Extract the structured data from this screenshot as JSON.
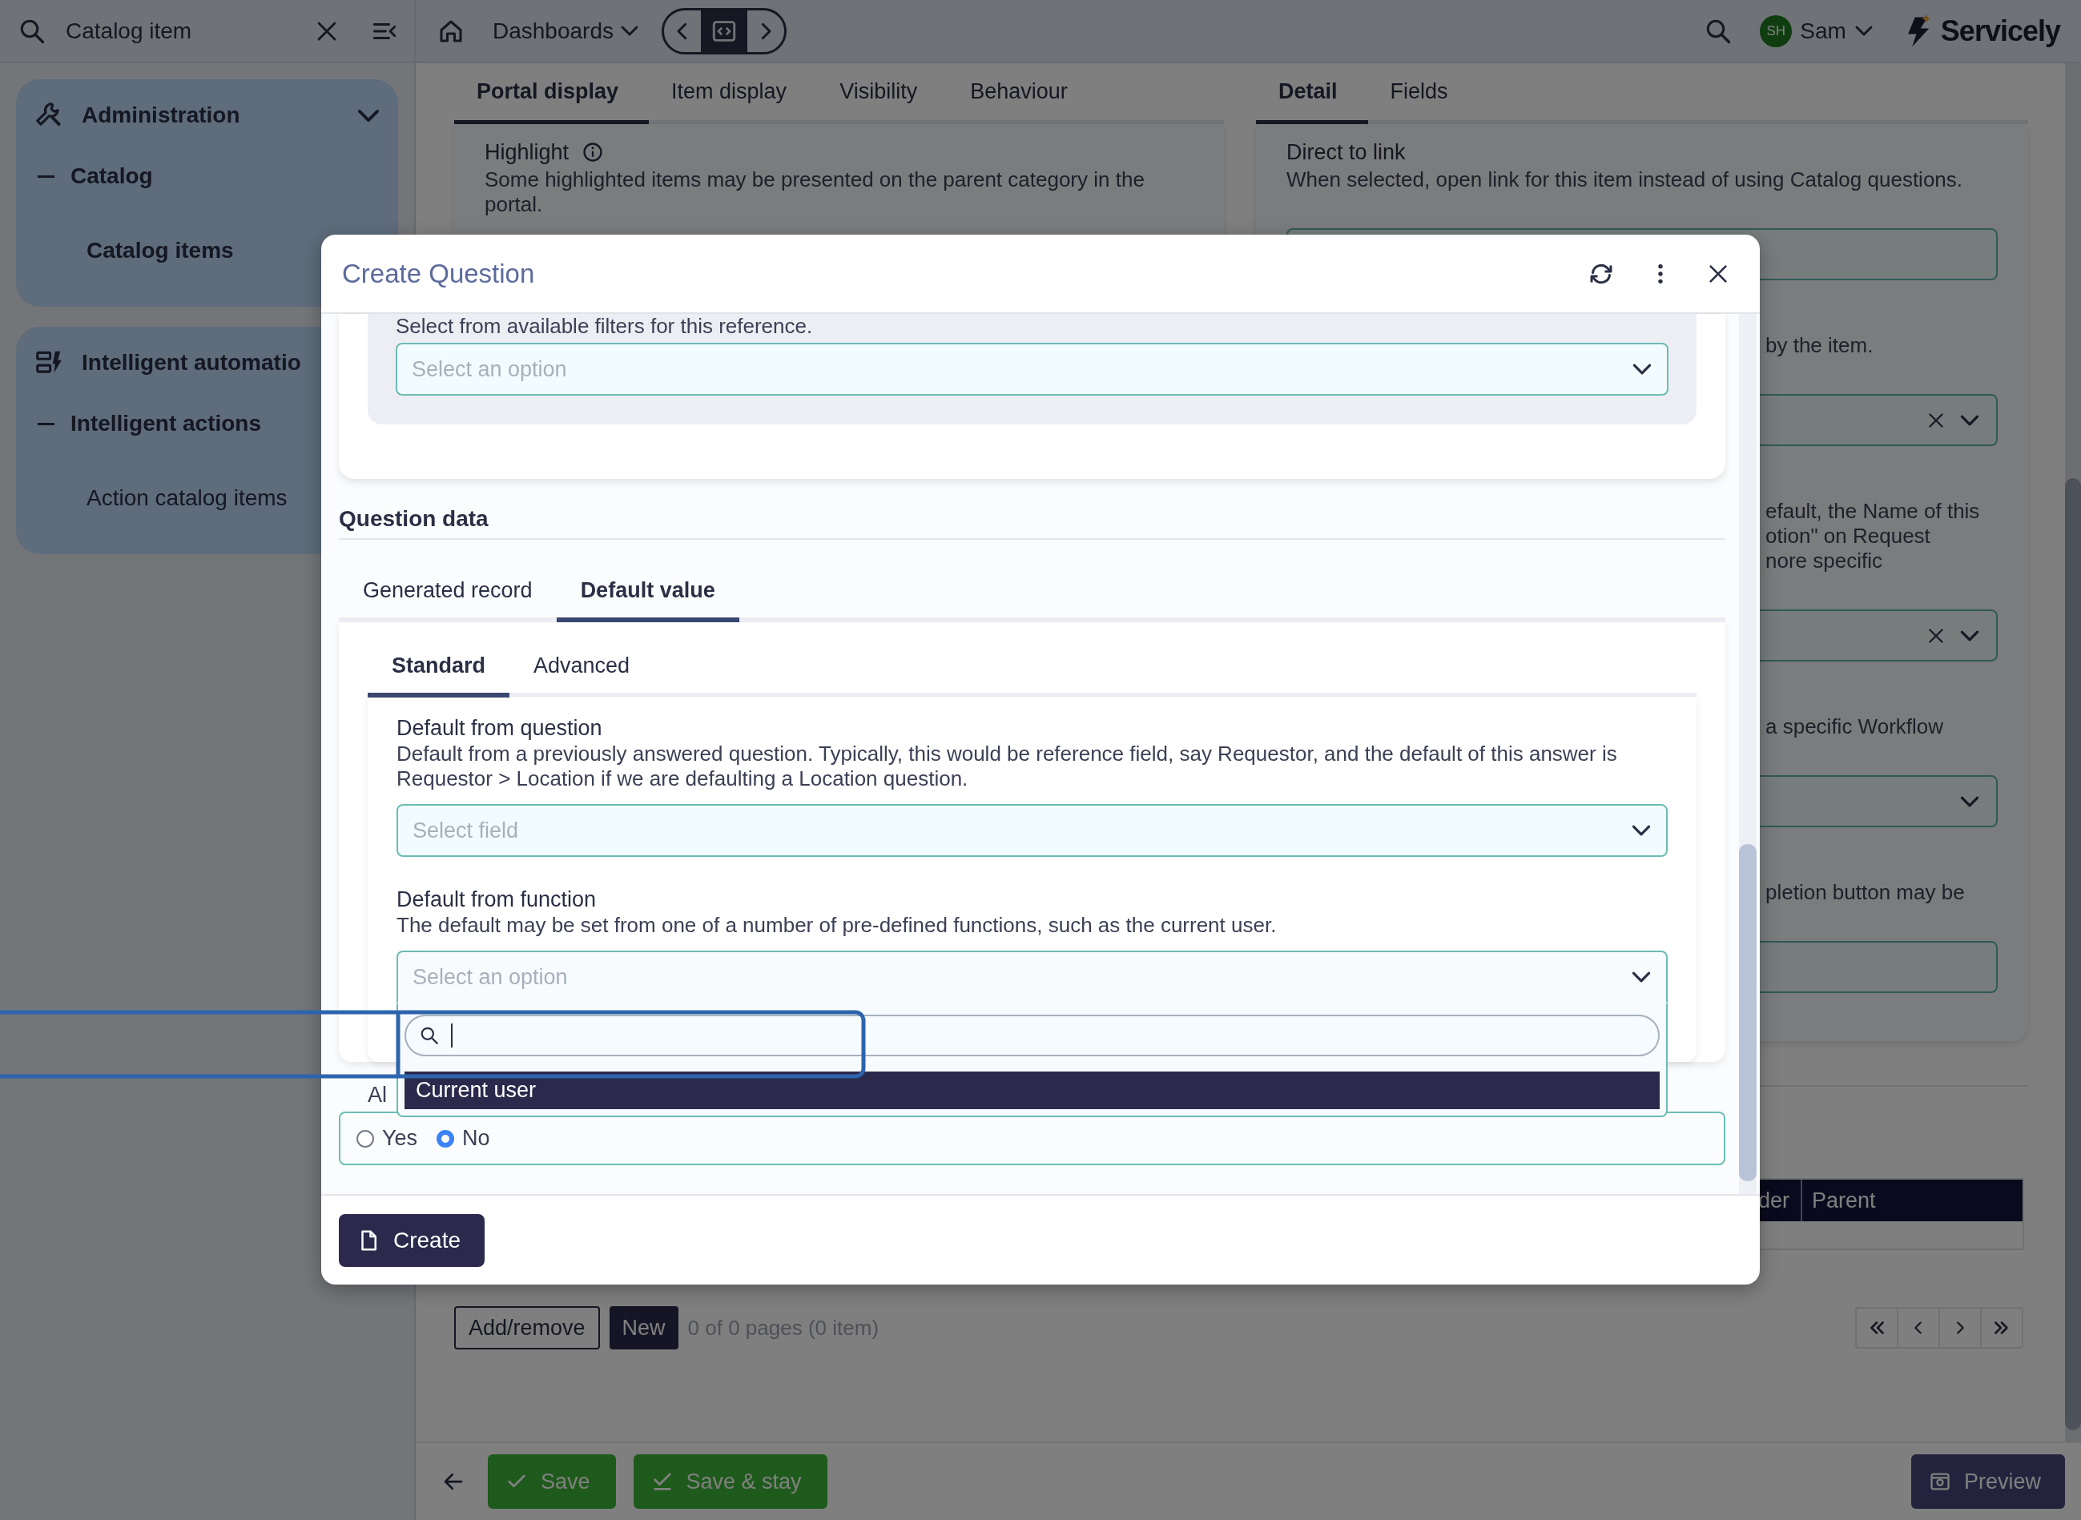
{
  "top_bar": {
    "search": {
      "value": "Catalog item"
    },
    "dashboards_menu": "Dashboards",
    "user": {
      "initials": "SH",
      "name": "Sam"
    },
    "logo": "Servicely"
  },
  "sidebar": {
    "groups": [
      {
        "title": "Administration",
        "expanded": true,
        "children": [
          {
            "label": "Catalog",
            "children": [
              {
                "label": "Catalog items",
                "selected": true
              }
            ]
          }
        ]
      },
      {
        "title": "Intelligent automatio",
        "children": [
          {
            "label": "Intelligent actions",
            "children": [
              {
                "label": "Action catalog items",
                "selected": false
              }
            ]
          }
        ]
      }
    ]
  },
  "form": {
    "left_tabs": [
      {
        "label": "Portal display",
        "selected": true
      },
      {
        "label": "Item display",
        "selected": false
      },
      {
        "label": "Visibility",
        "selected": false
      },
      {
        "label": "Behaviour",
        "selected": false
      }
    ],
    "right_tabs": [
      {
        "label": "Detail",
        "selected": true
      },
      {
        "label": "Fields",
        "selected": false
      }
    ],
    "left_panel": {
      "label": "Highlight",
      "description": "Some highlighted items may be presented on the parent category in the portal."
    },
    "right_panel": {
      "label": "Direct to link",
      "description": "When selected, open link for this item instead of using Catalog questions.",
      "items": [
        {
          "kind": "input"
        },
        {
          "kind": "text",
          "lines": [
            "by the item."
          ]
        },
        {
          "kind": "select",
          "clearable": true
        },
        {
          "kind": "text",
          "lines": [
            "efault, the Name of this",
            "otion\" on Request",
            "nore specific"
          ]
        },
        {
          "kind": "select",
          "clearable": true
        },
        {
          "kind": "text",
          "lines": [
            "a specific Workflow"
          ]
        },
        {
          "kind": "select",
          "clearable": false
        },
        {
          "kind": "text",
          "lines": [
            "pletion button may be"
          ]
        },
        {
          "kind": "input"
        }
      ]
    },
    "table": {
      "columns": [
        "der",
        "Parent"
      ]
    },
    "list_actions": {
      "buttons": [
        "Add/remove",
        "New"
      ],
      "page_info": "0 of 0 pages (0 item)"
    }
  },
  "bottom_bar": {
    "buttons": [
      {
        "kind": "back"
      },
      {
        "kind": "save",
        "label": "Save"
      },
      {
        "kind": "save_stay",
        "label": "Save & stay"
      },
      {
        "kind": "preview",
        "label": "Preview"
      }
    ]
  },
  "modal": {
    "title": "Create Question",
    "filter": {
      "hint": "Select from available filters for this reference.",
      "placeholder": "Select an option"
    },
    "section_title": "Question data",
    "tabs": [
      {
        "label": "Generated record",
        "selected": false
      },
      {
        "label": "Default value",
        "selected": true
      }
    ],
    "subtabs": [
      {
        "label": "Standard",
        "selected": true
      },
      {
        "label": "Advanced",
        "selected": false
      }
    ],
    "fields": [
      {
        "label": "Default from question",
        "description": "Default from a previously answered question. Typically, this would be reference field, say Requestor, and the default of this answer is Requestor > Location if we are defaulting a Location question.",
        "placeholder": "Select field",
        "open": false
      },
      {
        "label": "Default from function",
        "description": "The default may be set from one of a number of pre-defined functions, such as the current user.",
        "placeholder": "Select an option",
        "open": true
      }
    ],
    "dropdown": {
      "options": [
        {
          "label": "Current user",
          "selected": true
        }
      ]
    },
    "always": {
      "label": "Al",
      "options": [
        {
          "label": "Yes",
          "selected": false
        },
        {
          "label": "No",
          "selected": true
        }
      ]
    },
    "create_button": "Create"
  }
}
